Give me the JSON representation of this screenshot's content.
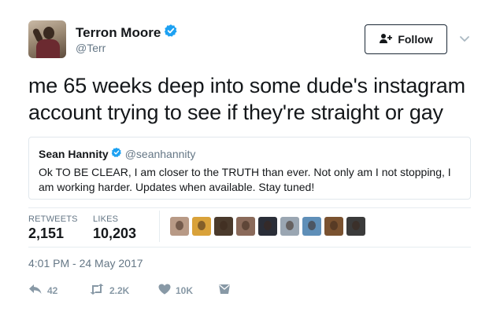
{
  "author": {
    "display_name": "Terron Moore",
    "handle": "@Terr",
    "verified": true
  },
  "follow_button": {
    "label": "Follow",
    "icon": "add-person-icon"
  },
  "tweet": {
    "text": "me 65 weeks deep into some dude's instagram account trying to see if they're straight or gay"
  },
  "quoted_tweet": {
    "display_name": "Sean Hannity",
    "handle": "@seanhannity",
    "verified": true,
    "text": "Ok TO BE CLEAR, I am closer to the TRUTH than ever. Not only am I not stopping, I am working harder. Updates when available. Stay tuned!"
  },
  "stats": {
    "retweets_label": "RETWEETS",
    "retweets_value": "2,151",
    "likes_label": "LIKES",
    "likes_value": "10,203"
  },
  "liker_avatars": [
    {
      "color": "#b89a86"
    },
    {
      "color": "#d9a23a"
    },
    {
      "color": "#4a3a2c"
    },
    {
      "color": "#8a6a5a"
    },
    {
      "color": "#2a2e38"
    },
    {
      "color": "#9aa6b2"
    },
    {
      "color": "#5f8fb8"
    },
    {
      "color": "#7a5230"
    },
    {
      "color": "#3b3b3b"
    }
  ],
  "timestamp": "4:01 PM - 24 May 2017",
  "actions": {
    "reply_count": "42",
    "retweet_count": "2.2K",
    "like_count": "10K"
  },
  "colors": {
    "verified_blue": "#1da1f2",
    "text": "#14171a",
    "muted": "#657786",
    "action_gray": "#8899a6"
  }
}
